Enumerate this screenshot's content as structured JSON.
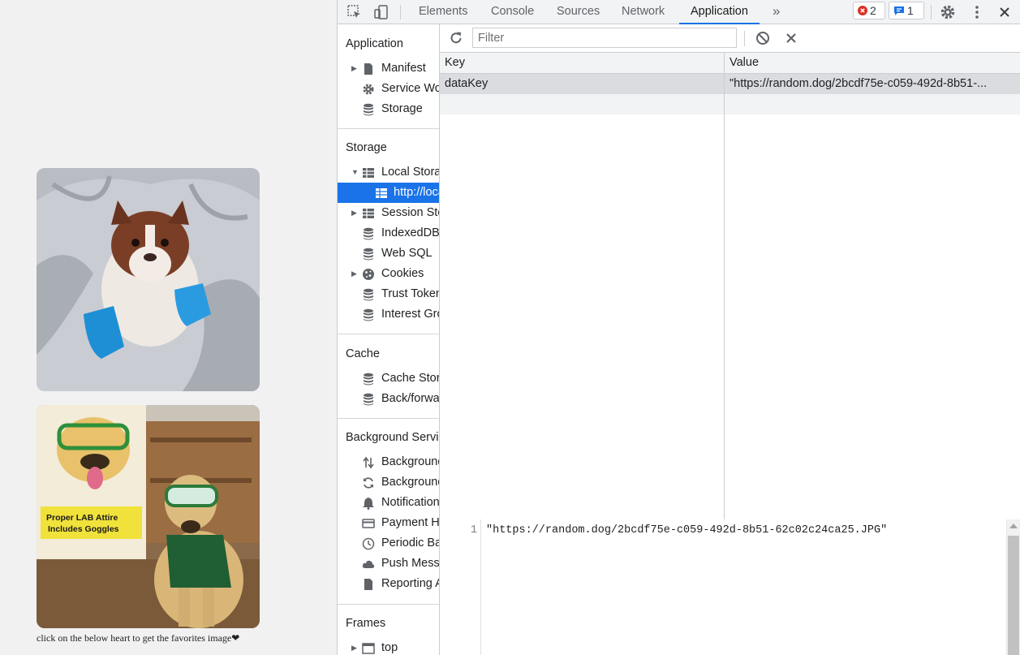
{
  "page": {
    "caption": "click on the below heart to get the favorites image",
    "heart_icon": "heart-icon",
    "images": [
      {
        "name": "dog-photo-bulldog-blanket",
        "desc_icon": "photo"
      },
      {
        "name": "dog-photo-lab-goggles",
        "desc_icon": "photo"
      }
    ],
    "poster_text": "Proper LAB Attire Includes Goggles"
  },
  "devtools": {
    "tabs": [
      "Elements",
      "Console",
      "Sources",
      "Network",
      "Application"
    ],
    "active_tab": "Application",
    "more_tabs": "»",
    "error_count": "2",
    "message_count": "1",
    "colors": {
      "accent": "#1a73e8",
      "error": "#d93025"
    },
    "sidebar": {
      "application_title": "Application",
      "application_items": [
        "Manifest",
        "Service Workers",
        "Storage"
      ],
      "storage_title": "Storage",
      "storage_items": [
        "Local Storage",
        "http://localhost",
        "Session Storage",
        "IndexedDB",
        "Web SQL",
        "Cookies",
        "Trust Tokens",
        "Interest Groups"
      ],
      "cache_title": "Cache",
      "cache_items": [
        "Cache Storage",
        "Back/forward cache"
      ],
      "bg_title": "Background Services",
      "bg_items": [
        "Background Fetch",
        "Background Sync",
        "Notifications",
        "Payment Handler",
        "Periodic Background Sync",
        "Push Messaging",
        "Reporting API"
      ],
      "frames_title": "Frames",
      "frames_items": [
        "top"
      ]
    },
    "toolbar": {
      "filter_placeholder": "Filter",
      "refresh_icon": "refresh-icon",
      "clear_icon": "block-icon",
      "delete_icon": "close-icon"
    },
    "table": {
      "headers": [
        "Key",
        "Value"
      ],
      "rows": [
        {
          "key": "dataKey",
          "value": "\"https://random.dog/2bcdf75e-c059-492d-8b51-..."
        }
      ]
    },
    "preview": {
      "line_number": "1",
      "code": "\"https://random.dog/2bcdf75e-c059-492d-8b51-62c02c24ca25.JPG\""
    }
  }
}
